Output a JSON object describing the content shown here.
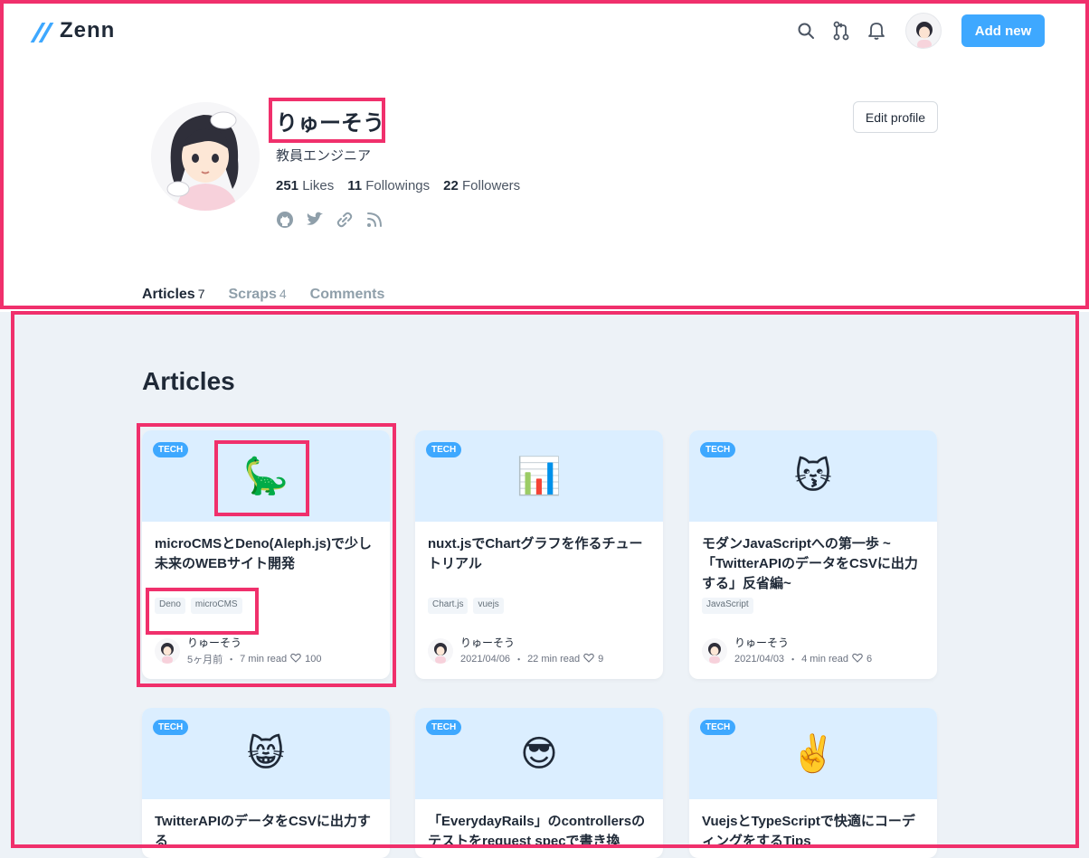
{
  "header": {
    "logo_text": "Zenn",
    "add_new_label": "Add new"
  },
  "profile": {
    "name": "りゅーそう",
    "bio": "教員エンジニア",
    "likes_count": "251",
    "likes_label": "Likes",
    "followings_count": "11",
    "followings_label": "Followings",
    "followers_count": "22",
    "followers_label": "Followers",
    "edit_label": "Edit profile"
  },
  "tabs": [
    {
      "label": "Articles",
      "count": "7"
    },
    {
      "label": "Scraps",
      "count": "4"
    },
    {
      "label": "Comments",
      "count": ""
    }
  ],
  "articles": {
    "heading": "Articles",
    "items": [
      {
        "badge": "TECH",
        "emoji": "🦕",
        "title": "microCMSとDeno(Aleph.js)で少し未来のWEBサイト開発",
        "tags": [
          "Deno",
          "microCMS"
        ],
        "author": "りゅーそう",
        "date": "5ヶ月前",
        "read": "7 min read",
        "likes": "100"
      },
      {
        "badge": "TECH",
        "emoji": "📊",
        "title": "nuxt.jsでChartグラフを作るチュートリアル",
        "tags": [
          "Chart.js",
          "vuejs"
        ],
        "author": "りゅーそう",
        "date": "2021/04/06",
        "read": "22 min read",
        "likes": "9"
      },
      {
        "badge": "TECH",
        "emoji": "😽",
        "title": "モダンJavaScriptへの第一歩 ~「TwitterAPIのデータをCSVに出力する」反省編~",
        "tags": [
          "JavaScript"
        ],
        "author": "りゅーそう",
        "date": "2021/04/03",
        "read": "4 min read",
        "likes": "6"
      },
      {
        "badge": "TECH",
        "emoji": "😸",
        "title": "TwitterAPIのデータをCSVに出力する",
        "tags": [],
        "author": "",
        "date": "",
        "read": "",
        "likes": ""
      },
      {
        "badge": "TECH",
        "emoji": "😎",
        "title": "「EverydayRails」のcontrollersのテストをrequest specで書き換",
        "tags": [],
        "author": "",
        "date": "",
        "read": "",
        "likes": ""
      },
      {
        "badge": "TECH",
        "emoji": "✌️",
        "title": "VuejsとTypeScriptで快適にコーディングをするTips",
        "tags": [],
        "author": "",
        "date": "",
        "read": "",
        "likes": ""
      }
    ]
  },
  "colors": {
    "accent": "#3ea8ff",
    "annotation": "#f0306c",
    "articles_bg": "#edf2f7",
    "card_top": "#dbeeff"
  },
  "icons": [
    "search-icon",
    "pull-request-icon",
    "bell-icon",
    "github-icon",
    "twitter-icon",
    "link-icon",
    "rss-icon",
    "heart-icon"
  ]
}
